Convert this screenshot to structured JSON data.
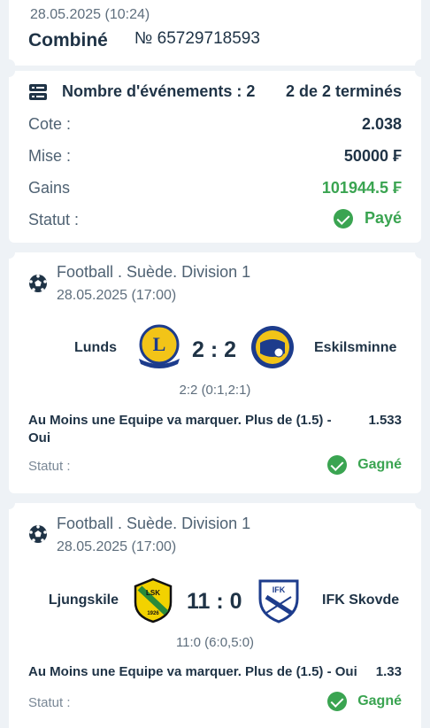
{
  "header": {
    "date": "28.05.2025 (10:24)",
    "bet_type": "Combiné",
    "ticket_number": "№ 65729718593"
  },
  "summary": {
    "events_label": "Nombre d'événements : 2",
    "state": "2 de 2 terminés",
    "rows": [
      {
        "label": "Cote :",
        "value": "2.038"
      },
      {
        "label": "Mise :",
        "value": "50000 ₣"
      },
      {
        "label": "Gains",
        "value": "101944.5 ₣"
      },
      {
        "label": "Statut :",
        "value": "Payé"
      }
    ],
    "colors": {
      "accent_green": "#3aa451",
      "text_dark": "#1f3346"
    }
  },
  "events": [
    {
      "league": "Football . Suède. Division 1",
      "date": "28.05.2025 (17:00)",
      "home": "Lunds",
      "away": "Eskilsminne",
      "score": "2 : 2",
      "detail": "2:2 (0:1,2:1)",
      "market_line1": "Au Moins une Equipe va marquer. Plus de (1.5) -",
      "market_line2": "Oui",
      "odds": "1.533",
      "status_label": "Statut :",
      "status": "Gagné",
      "home_logo": "lunds-bk-crest",
      "away_logo": "eskilsminne-crest"
    },
    {
      "league": "Football . Suède. Division 1",
      "date": "28.05.2025 (17:00)",
      "home": "Ljungskile",
      "away": "IFK Skovde",
      "score": "11 : 0",
      "detail": "11:0 (6:0,5:0)",
      "market_line1": "Au Moins une Equipe va marquer. Plus de (1.5) - Oui",
      "odds": "1.33",
      "status_label": "Statut :",
      "status": "Gagné",
      "home_logo": "ljungskile-sk-crest",
      "away_logo": "ifk-skovde-crest"
    }
  ]
}
